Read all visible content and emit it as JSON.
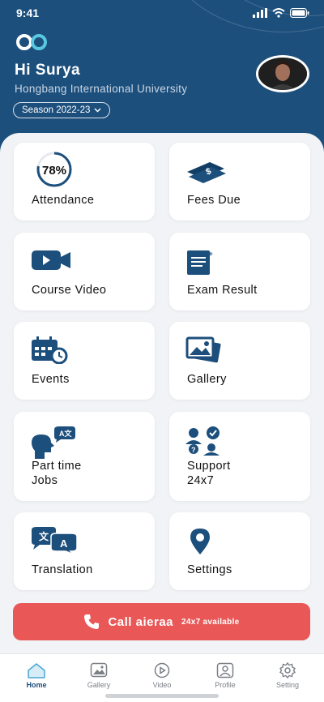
{
  "status_bar": {
    "time": "9:41"
  },
  "header": {
    "greeting": "Hi Surya",
    "university": "Hongbang International University",
    "season_label": "Season 2022-23"
  },
  "cards": [
    {
      "id": "attendance",
      "label": "Attendance",
      "percent": "78%",
      "progress": 0.78,
      "icon": "progress-ring-icon"
    },
    {
      "id": "fees-due",
      "label": "Fees Due",
      "icon": "money-icon"
    },
    {
      "id": "course-video",
      "label": "Course Video",
      "icon": "video-camera-icon"
    },
    {
      "id": "exam-result",
      "label": "Exam Result",
      "icon": "exam-paper-icon"
    },
    {
      "id": "events",
      "label": "Events",
      "icon": "calendar-clock-icon"
    },
    {
      "id": "gallery",
      "label": "Gallery",
      "icon": "photos-icon"
    },
    {
      "id": "part-time-jobs",
      "label": "Part time\nJobs",
      "icon": "speaking-head-icon"
    },
    {
      "id": "support",
      "label": "Support\n24x7",
      "icon": "support-people-icon"
    },
    {
      "id": "translation",
      "label": "Translation",
      "icon": "translate-icon"
    },
    {
      "id": "settings",
      "label": "Settings",
      "icon": "location-pin-icon"
    }
  ],
  "call_button": {
    "label": "Call aieraa",
    "sublabel": "24x7 available"
  },
  "tabs": [
    {
      "id": "home",
      "label": "Home",
      "active": true
    },
    {
      "id": "gallery",
      "label": "Gallery",
      "active": false
    },
    {
      "id": "video",
      "label": "Video",
      "active": false
    },
    {
      "id": "profile",
      "label": "Profile",
      "active": false
    },
    {
      "id": "setting",
      "label": "Setting",
      "active": false
    }
  ],
  "colors": {
    "primary": "#1d4f7c",
    "accent": "#e95757",
    "background": "#f1f3f6"
  }
}
